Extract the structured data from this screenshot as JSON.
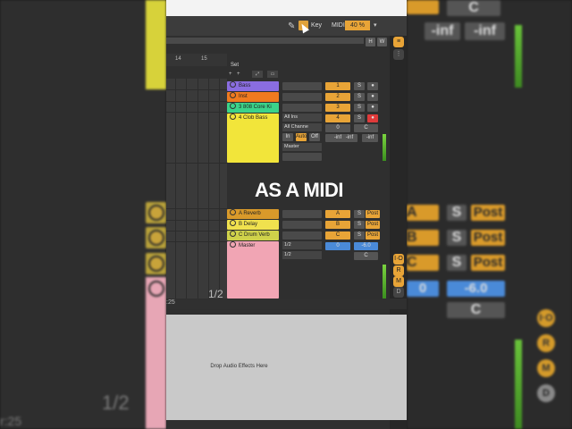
{
  "toolbar": {
    "key_label": "Key",
    "midi_label": "MIDI",
    "zoom": "40 %",
    "h_label": "H",
    "w_label": "W"
  },
  "ruler": {
    "n14": "14",
    "n15": "15"
  },
  "set": {
    "label": "Set",
    "plus1": "+",
    "plus2": "+"
  },
  "tracks": [
    {
      "name": "Bass",
      "num": "1",
      "s": "S",
      "color": "#8a6de0"
    },
    {
      "name": "Inst",
      "num": "2",
      "s": "S",
      "color": "#f07a1f"
    },
    {
      "name": "3 808 Core Ki",
      "num": "3",
      "s": "S",
      "color": "#3bd38a"
    },
    {
      "name": "4 Clob Bass",
      "num": "4",
      "s": "S",
      "color": "#f2e53a"
    }
  ],
  "io": {
    "all_ins": "All Ins",
    "all_channels": "All Channe",
    "in": "In",
    "auto": "Auto",
    "off": "Off",
    "master": "Master",
    "zero": "0",
    "c": "C",
    "inf1": "-inf",
    "inf2": "-inf",
    "inf3": "-inf"
  },
  "caption": "AS A MIDI",
  "returns": [
    {
      "name": "A Reverb",
      "letter": "A",
      "s": "S",
      "post": "Post"
    },
    {
      "name": "B Delay",
      "letter": "B",
      "s": "S",
      "post": "Post"
    },
    {
      "name": "C Drum Verb",
      "letter": "C",
      "s": "S",
      "post": "Post"
    }
  ],
  "master": {
    "name": "Master",
    "half1": "1/2",
    "half2": "1/2",
    "zero": "0",
    "vol": "-6.0",
    "c": "C"
  },
  "overlay": {
    "half": "1/2",
    "time": ":25"
  },
  "drop": "Drop Audio Effects Here",
  "side": {
    "io": "I·O",
    "r": "R",
    "m": "M",
    "d": "D"
  },
  "right_bg": {
    "c": "C",
    "inf1": "-inf",
    "inf2": "-inf",
    "s1": "S",
    "s2": "S",
    "s3": "S",
    "post1": "Post",
    "post2": "Post",
    "post3": "Post",
    "a": "A",
    "b": "B",
    "cc": "C",
    "zero": "0",
    "vol": "-6.0",
    "c2": "C",
    "io": "I·O",
    "r": "R",
    "m": "M",
    "d": "D"
  },
  "left_bg": {
    "half": "1/2",
    "time": "r:25"
  },
  "colors": {
    "accent": "#e8a437",
    "master_pink": "#f1a5b4",
    "clob_yellow": "#f2e53a"
  }
}
